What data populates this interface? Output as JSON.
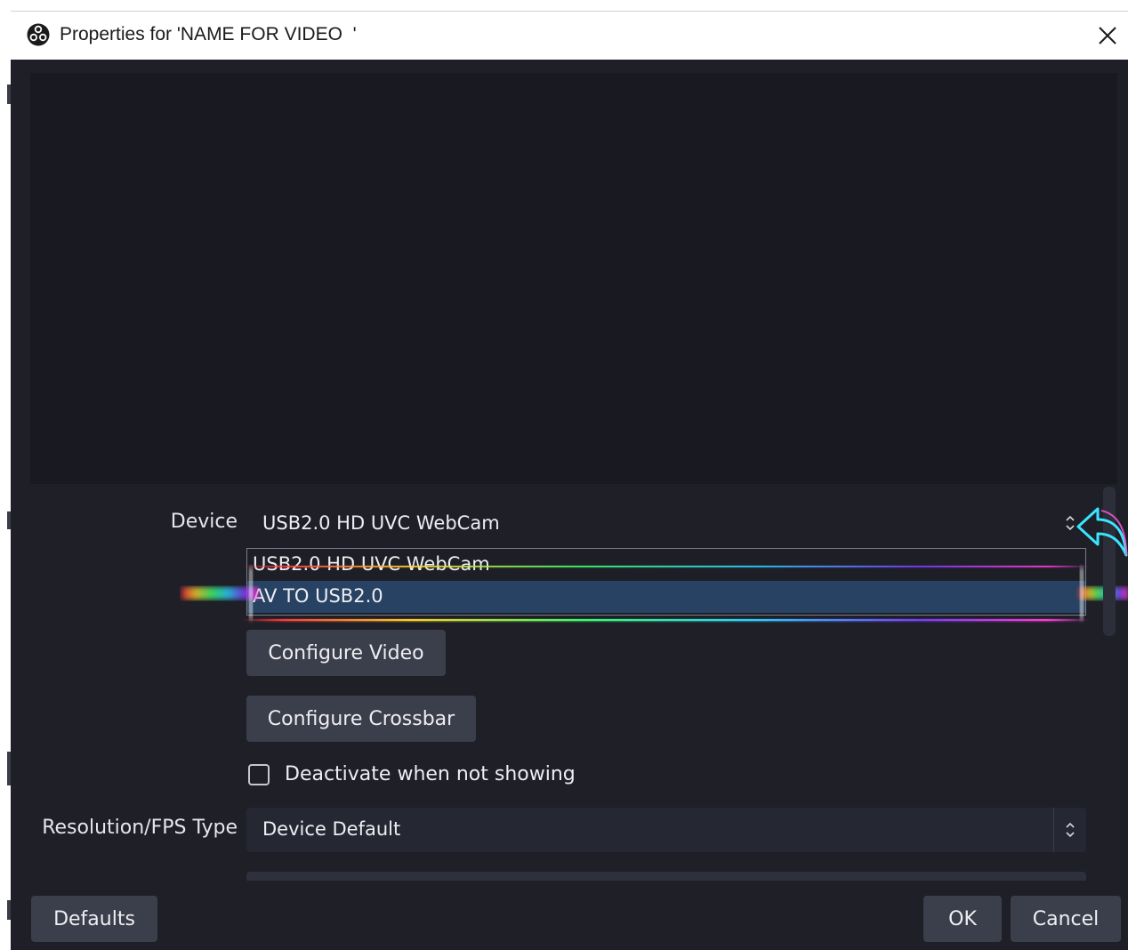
{
  "window": {
    "title": "Properties for 'NAME FOR VIDEO  '"
  },
  "icons": {
    "app": "obs-logo-icon",
    "close": "close-icon",
    "combo_arrow": "up-down-chevron-icon",
    "cursor": "curved-arrow-pointer-icon"
  },
  "device": {
    "label": "Device",
    "value": "USB2.0 HD UVC WebCam",
    "options": [
      "USB2.0 HD UVC WebCam",
      "AV TO USB2.0"
    ],
    "highlighted_option": "AV TO USB2.0"
  },
  "buttons": {
    "configure_video": "Configure Video",
    "configure_crossbar": "Configure Crossbar",
    "defaults": "Defaults",
    "ok": "OK",
    "cancel": "Cancel"
  },
  "deactivate": {
    "label": "Deactivate when not showing",
    "checked": false
  },
  "resolution": {
    "label": "Resolution/FPS Type",
    "value": "Device Default"
  },
  "colors": {
    "dialog_bg": "#1e1f27",
    "input_bg": "#252733",
    "button_bg": "#3b3e4b",
    "selection": "#274262"
  }
}
